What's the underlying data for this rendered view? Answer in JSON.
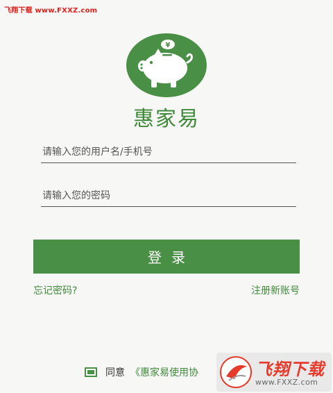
{
  "watermark": {
    "top_text": "飞翔下载 www.FXXZ.com",
    "badge_title": "飞翔下载",
    "badge_url": "www.FXXZ.com"
  },
  "logo": {
    "symbol": "¥",
    "icon": "piggy-bank-icon",
    "circle_color": "#4a8f46"
  },
  "app": {
    "name": "惠家易"
  },
  "form": {
    "username_placeholder": "请输入您的用户名/手机号",
    "password_placeholder": "请输入您的密码",
    "login_label": "登录"
  },
  "links": {
    "forgot": "忘记密码?",
    "register": "注册新账号"
  },
  "agreement": {
    "agree_label": "同意",
    "agreement_link": "《惠家易使用协",
    "checked": true
  },
  "colors": {
    "brand_green": "#4a8f46",
    "background": "#f7f7f5",
    "watermark_red": "#e0201b"
  }
}
